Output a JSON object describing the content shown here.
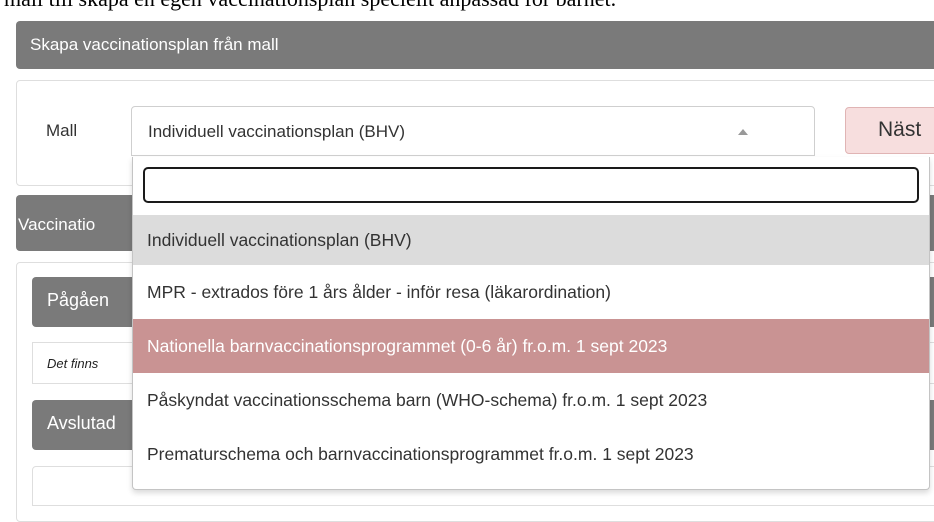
{
  "page": {
    "top_text": "mall till skapa en egen vaccinationsplan speciellt anpassad för barnet."
  },
  "template_panel": {
    "title": "Skapa vaccinationsplan från mall",
    "label": "Mall",
    "selected_value": "Individuell vaccinationsplan (BHV)",
    "next_button_label": "Näst"
  },
  "vaccination_panel": {
    "title": "Vaccinatio",
    "ongoing_title": "Pågåen",
    "empty_note": "Det finns",
    "finished_title": "Avslutad"
  },
  "dropdown": {
    "search_value": "",
    "options": [
      {
        "label": "Individuell vaccinationsplan (BHV)",
        "state": "selected"
      },
      {
        "label": "MPR - extrados före 1 års ålder - inför resa (läkarordination)",
        "state": "normal"
      },
      {
        "label": "Nationella barnvaccinationsprogrammet (0-6 år) fr.o.m. 1 sept 2023",
        "state": "highlighted"
      },
      {
        "label": "Påskyndat vaccinationsschema barn (WHO-schema) fr.o.m. 1 sept 2023",
        "state": "normal"
      },
      {
        "label": "Prematurschema och barnvaccinationsprogrammet fr.o.m. 1 sept 2023",
        "state": "normal"
      }
    ]
  },
  "colors": {
    "header_bg": "#7a7a7a",
    "highlight_bg": "#c99393",
    "selected_bg": "#dcdcdc",
    "next_button_bg": "#f7dede"
  }
}
